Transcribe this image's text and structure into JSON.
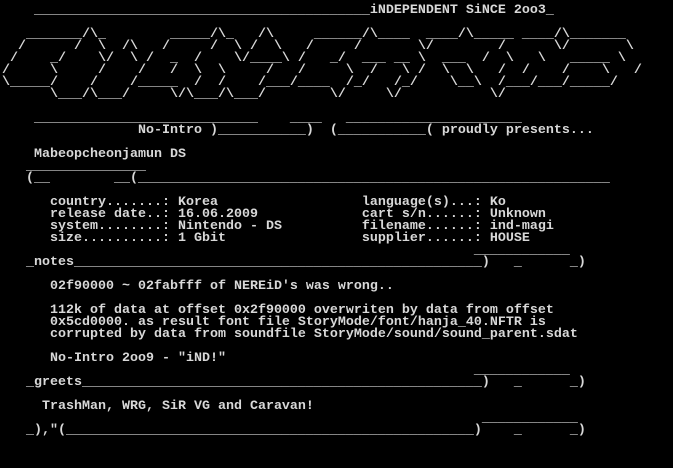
{
  "viewer": {
    "background": "#000000",
    "text_color": "#d8d8d8"
  },
  "nfo": {
    "lines": [
      "",
      "    __________________________________________iNDEPENDENT SiNCE 2oo3_",
      "",
      "   _______/\\_        _____/\\_   /\\     ______/\\____  ____/\\_____ ____/\\_______",
      "  /      /  \\  /\\   /     /  \\ /  \\   /     /       \\/        /      \\/       \\",
      " /    _/    \\/  \\ /  _  /    \\/____\\ /   _/  ___ __ \\  ___  /  \\   \\   _____ \\",
      "/     \\     /    /   /  \\  \\     /   /     \\  /   \\ /  \\  \\   /  /    /    \\   /",
      "\\_____/    /    /_____  /  /    /___/____  /_/   /_/    \\__\\  /___/___/_____/",
      "      \\___/\\___/     \\/\\___/\\___/        \\/     \\/           \\/",
      "",
      "    ____________________________    ____   ______________________",
      "                 No-Intro )___________)  (___________( proudly presents...",
      "",
      "    Mabeopcheonjamun DS",
      "   _______________",
      "   (__        __(___________________________________________________________",
      "",
      "      country.......: Korea                  language(s)...: Ko",
      "      release date..: 16.06.2009             cart s/n......: Unknown",
      "      system........: Nintendo - DS          filename......: ind-magi",
      "      size..........: 1 Gbit                 supplier......: HOUSE",
      "                                                           ____________",
      "   _notes___________________________________________________)   _      _)",
      "",
      "      02f90000 ~ 02fabfff of NEREiD's was wrong..",
      "",
      "      112k of data at offset 0x2f90000 overwriten by data from offset",
      "      0x5cd0000. as result font file StoryMode/font/hanja_40.NFTR is",
      "      corrupted by data from soundfile StoryMode/sound/sound_parent.sdat",
      "",
      "      No-Intro 2oo9 - \"iND!\"",
      "                                                           ____________",
      "   _greets__________________________________________________)   _      _)",
      "",
      "     TrashMan, WRG, SiR VG and Caravan!",
      "                                                            ____________",
      "   _),\"(___________________________________________________)    _      _)"
    ]
  }
}
